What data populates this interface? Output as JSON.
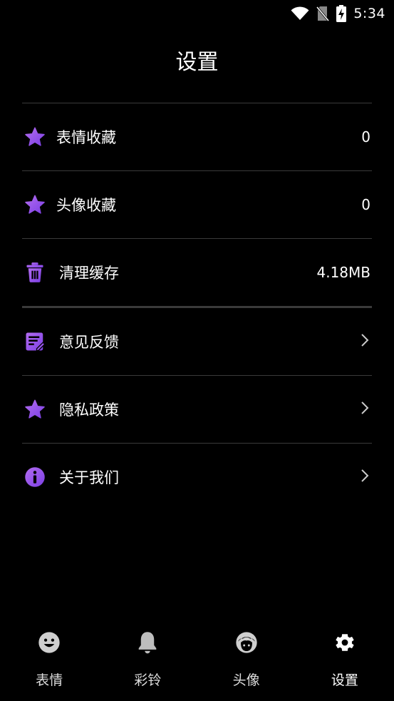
{
  "status_bar": {
    "time": "5:34"
  },
  "header": {
    "title": "设置"
  },
  "settings": {
    "items": [
      {
        "label": "表情收藏",
        "value": "0",
        "icon": "star-icon"
      },
      {
        "label": "头像收藏",
        "value": "0",
        "icon": "star-icon"
      },
      {
        "label": "清理缓存",
        "value": "4.18MB",
        "icon": "trash-icon"
      },
      {
        "label": "意见反馈",
        "icon": "feedback-note-icon"
      },
      {
        "label": "隐私政策",
        "icon": "star-icon"
      },
      {
        "label": "关于我们",
        "icon": "info-icon"
      }
    ]
  },
  "bottom_nav": {
    "items": [
      {
        "label": "表情",
        "icon": "smiley-icon"
      },
      {
        "label": "彩铃",
        "icon": "bell-icon"
      },
      {
        "label": "头像",
        "icon": "avatar-face-icon"
      },
      {
        "label": "设置",
        "icon": "gear-icon",
        "active": true
      }
    ]
  },
  "colors": {
    "accent_gradient_start": "#7b3fe4",
    "accent_gradient_end": "#b36cf0",
    "background": "#000000"
  }
}
